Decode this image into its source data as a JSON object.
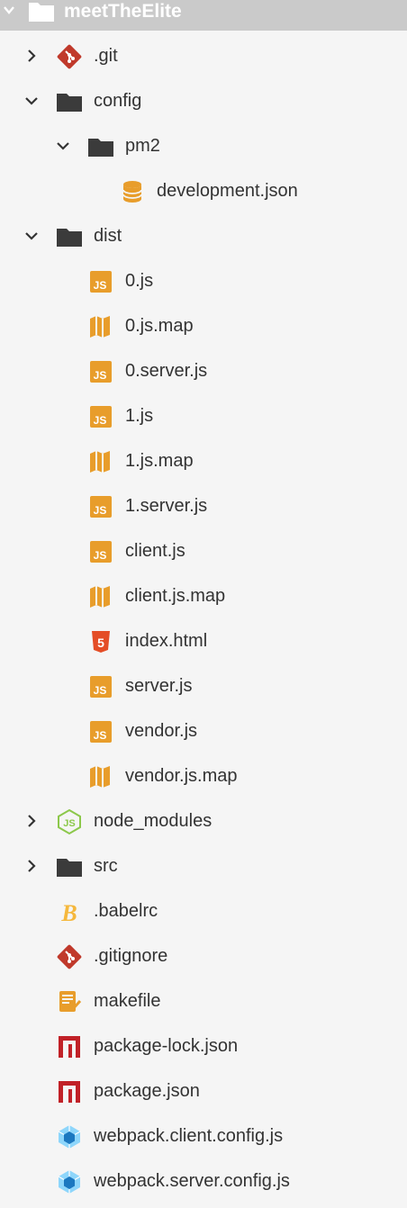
{
  "project": {
    "name": "meetTheElite"
  },
  "tree": [
    {
      "label": ".git",
      "icon": "git-icon",
      "chevron": "right"
    },
    {
      "label": "config",
      "icon": "folder-icon",
      "chevron": "down"
    },
    {
      "label": "pm2",
      "icon": "folder-icon",
      "chevron": "down"
    },
    {
      "label": "development.json",
      "icon": "database-icon"
    },
    {
      "label": "dist",
      "icon": "folder-icon",
      "chevron": "down"
    },
    {
      "label": "0.js",
      "icon": "javascript-icon"
    },
    {
      "label": "0.js.map",
      "icon": "map-icon"
    },
    {
      "label": "0.server.js",
      "icon": "javascript-icon"
    },
    {
      "label": "1.js",
      "icon": "javascript-icon"
    },
    {
      "label": "1.js.map",
      "icon": "map-icon"
    },
    {
      "label": "1.server.js",
      "icon": "javascript-icon"
    },
    {
      "label": "client.js",
      "icon": "javascript-icon"
    },
    {
      "label": "client.js.map",
      "icon": "map-icon"
    },
    {
      "label": "index.html",
      "icon": "html5-icon"
    },
    {
      "label": "server.js",
      "icon": "javascript-icon"
    },
    {
      "label": "vendor.js",
      "icon": "javascript-icon"
    },
    {
      "label": "vendor.js.map",
      "icon": "map-icon"
    },
    {
      "label": "node_modules",
      "icon": "nodejs-icon",
      "chevron": "right"
    },
    {
      "label": "src",
      "icon": "folder-icon",
      "chevron": "right"
    },
    {
      "label": ".babelrc",
      "icon": "babel-icon"
    },
    {
      "label": ".gitignore",
      "icon": "git-icon"
    },
    {
      "label": "makefile",
      "icon": "makefile-icon"
    },
    {
      "label": "package-lock.json",
      "icon": "npm-icon"
    },
    {
      "label": "package.json",
      "icon": "npm-icon"
    },
    {
      "label": "webpack.client.config.js",
      "icon": "webpack-icon"
    },
    {
      "label": "webpack.server.config.js",
      "icon": "webpack-icon"
    }
  ],
  "colors": {
    "header_bg": "#cacaca",
    "background": "#f5f5f5",
    "text": "#333333",
    "folder": "#3b3b3b",
    "javascript": "#e89d2b",
    "git": "#c0392b",
    "npm": "#c12127",
    "nodejs": "#8cc84b",
    "webpack": "#8ed6fb",
    "html5": "#e44d26"
  }
}
